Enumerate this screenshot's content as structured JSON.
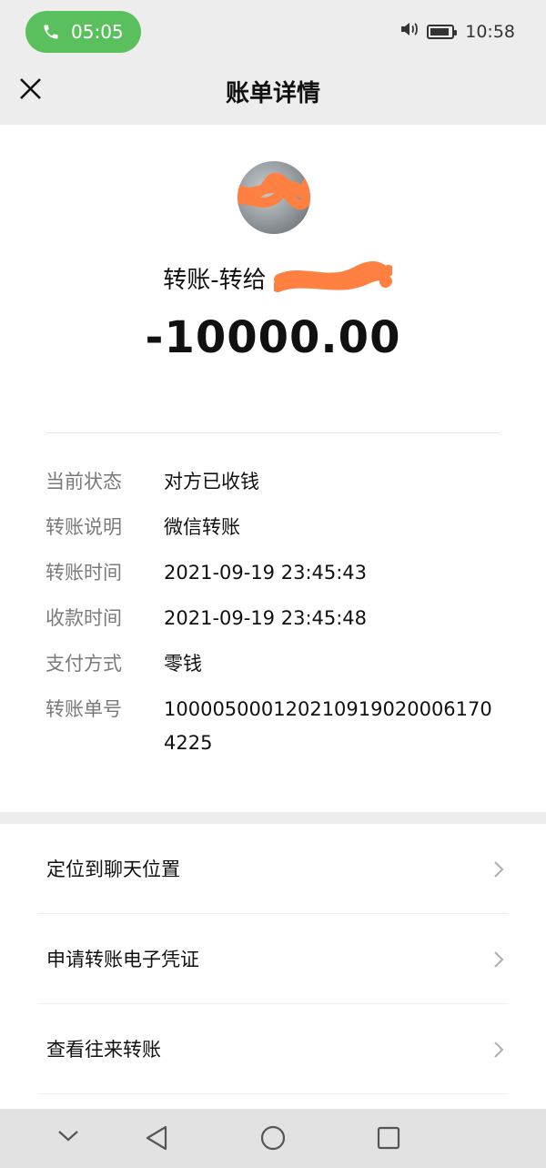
{
  "status_bar": {
    "call_timer": "05:05",
    "clock": "10:58"
  },
  "nav": {
    "title": "账单详情"
  },
  "transfer": {
    "title": "转账-转给",
    "amount": "-10000.00"
  },
  "details": [
    {
      "label": "当前状态",
      "value": "对方已收钱"
    },
    {
      "label": "转账说明",
      "value": "微信转账"
    },
    {
      "label": "转账时间",
      "value": "2021-09-19 23:45:43"
    },
    {
      "label": "收款时间",
      "value": "2021-09-19 23:45:48"
    },
    {
      "label": "支付方式",
      "value": "零钱"
    },
    {
      "label": "转账单号",
      "value": "1000050001202109190200061704225"
    }
  ],
  "actions": [
    {
      "label": "定位到聊天位置"
    },
    {
      "label": "申请转账电子凭证"
    },
    {
      "label": "查看往来转账"
    }
  ],
  "colors": {
    "call_pill": "#5ac05d",
    "redaction": "#ff8040",
    "background": "#ededed"
  }
}
